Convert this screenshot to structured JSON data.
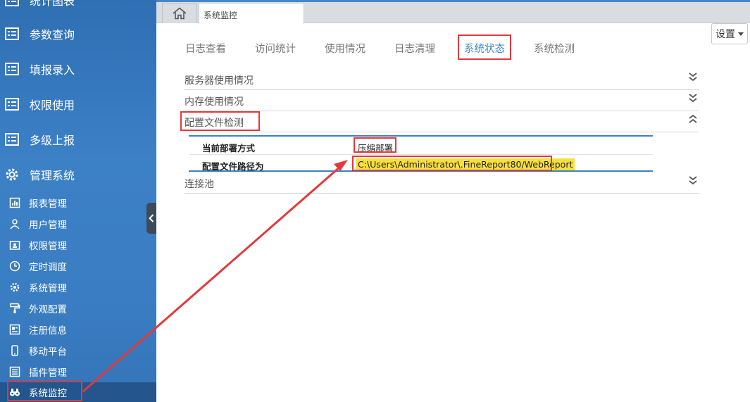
{
  "sidebar": {
    "top_partial_label": "统计图表",
    "menu": [
      {
        "label": "参数查询",
        "icon": "list-icon"
      },
      {
        "label": "填报录入",
        "icon": "list-icon"
      },
      {
        "label": "权限使用",
        "icon": "list-icon"
      },
      {
        "label": "多级上报",
        "icon": "list-icon"
      },
      {
        "label": "管理系统",
        "icon": "gear-icon"
      }
    ],
    "submenu": [
      {
        "label": "报表管理",
        "icon": "report-icon"
      },
      {
        "label": "用户管理",
        "icon": "user-icon"
      },
      {
        "label": "权限管理",
        "icon": "permission-icon"
      },
      {
        "label": "定时调度",
        "icon": "clock-icon"
      },
      {
        "label": "系统管理",
        "icon": "cog-icon"
      },
      {
        "label": "外观配置",
        "icon": "paint-roller-icon"
      },
      {
        "label": "注册信息",
        "icon": "registration-icon"
      },
      {
        "label": "移动平台",
        "icon": "mobile-icon"
      },
      {
        "label": "插件管理",
        "icon": "plugin-icon"
      },
      {
        "label": "系统监控",
        "icon": "binoculars-icon"
      }
    ],
    "active_submenu": "系统监控"
  },
  "topbar": {
    "home_icon": "home-icon",
    "active_tab": "系统监控"
  },
  "settings": {
    "label": "设置"
  },
  "tabs": [
    {
      "label": "日志查看"
    },
    {
      "label": "访问统计"
    },
    {
      "label": "使用情况"
    },
    {
      "label": "日志清理"
    },
    {
      "label": "系统状态"
    },
    {
      "label": "系统检测"
    }
  ],
  "active_tab": "系统状态",
  "sections": {
    "server_usage": {
      "title": "服务器使用情况",
      "expanded": false
    },
    "memory_usage": {
      "title": "内存使用情况",
      "expanded": false
    },
    "config_check": {
      "title": "配置文件检测",
      "expanded": true
    },
    "connection_pool": {
      "title": "连接池",
      "expanded": false
    }
  },
  "config": {
    "deploy_label": "当前部署方式",
    "deploy_value": "压缩部署",
    "path_label": "配置文件路径为",
    "path_value": "C:\\Users\\Administrator\\.FineReport80/WebReport"
  },
  "colors": {
    "sidebar_blue": "#3c80c6",
    "active_tab": "#3b88c7",
    "highlight_red": "#e2393c",
    "path_highlight": "#f7df3e"
  }
}
